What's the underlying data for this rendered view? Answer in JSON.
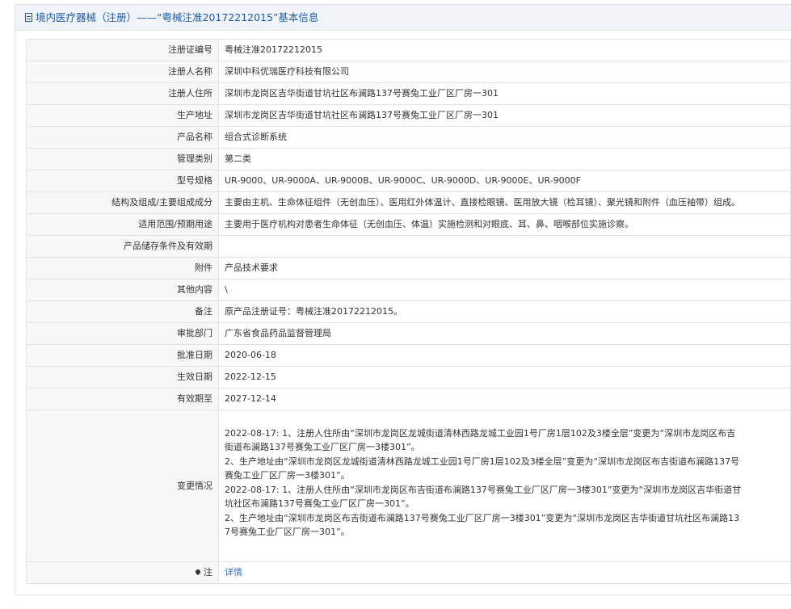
{
  "header": {
    "title": "境内医疗器械（注册）——“粤械注准20172212015”基本信息"
  },
  "rows": [
    {
      "label": "注册证编号",
      "value": "粤械注准20172212015"
    },
    {
      "label": "注册人名称",
      "value": "深圳中科优瑞医疗科技有限公司"
    },
    {
      "label": "注册人住所",
      "value": "深圳市龙岗区吉华街道甘坑社区布澜路137号赛兔工业厂区厂房一301"
    },
    {
      "label": "生产地址",
      "value": "深圳市龙岗区吉华街道甘坑社区布澜路137号赛兔工业厂区厂房一301"
    },
    {
      "label": "产品名称",
      "value": "组合式诊断系统"
    },
    {
      "label": "管理类别",
      "value": "第二类"
    },
    {
      "label": "型号规格",
      "value": "UR-9000、UR-9000A、UR-9000B、UR-9000C、UR-9000D、UR-9000E、UR-9000F"
    },
    {
      "label": "结构及组成/主要组成成分",
      "value": "主要由主机、生命体征组件（无创血压）、医用红外体温计、直接检眼镜、医用放大镜（检耳镜）、聚光镜和附件（血压袖带）组成。"
    },
    {
      "label": "适用范围/预期用途",
      "value": "主要用于医疗机构对患者生命体征（无创血压、体温）实施检测和对眼底、耳、鼻、咽喉部位实施诊察。"
    },
    {
      "label": "产品储存条件及有效期",
      "value": ""
    },
    {
      "label": "附件",
      "value": "产品技术要求"
    },
    {
      "label": "其他内容",
      "value": "\\"
    },
    {
      "label": "备注",
      "value": "原产品注册证号：粤械注准20172212015。"
    },
    {
      "label": "审批部门",
      "value": "广东省食品药品监督管理局"
    },
    {
      "label": "批准日期",
      "value": "2020-06-18"
    },
    {
      "label": "生效日期",
      "value": "2022-12-15"
    },
    {
      "label": "有效期至",
      "value": "2027-12-14"
    }
  ],
  "changes": {
    "label": "变更情况",
    "entry1_line1": "2022-08-17: 1、注册人住所由“深圳市龙岗区龙城街道清林西路龙城工业园1号厂房1层102及3楼全层”变更为“深圳市龙岗区布吉",
    "entry1_line2": "街道布澜路137号赛兔工业厂区厂房一3楼301”。",
    "entry1_line3": "2、生产地址由“深圳市龙岗区龙城街道清林西路龙城工业园1号厂房1层102及3楼全层”变更为“深圳市龙岗区布吉街道布澜路137号",
    "entry1_line4": "赛兔工业厂区厂房一3楼301”。",
    "entry2_line1": "2022-08-17: 1、注册人住所由“深圳市龙岗区布吉街道布澜路137号赛兔工业厂区厂房一3楼301”变更为“深圳市龙岗区吉华街道甘",
    "entry2_line2": "坑社区布澜路137号赛兔工业厂区厂房一301”。",
    "entry2_line3": "2、生产地址由“深圳市龙岗区布吉街道布澜路137号赛兔工业厂区厂房一3楼301”变更为“深圳市龙岗区吉华街道甘坑社区布澜路13",
    "entry2_line4": "7号赛兔工业厂区厂房一301”。"
  },
  "note": {
    "label": "注",
    "icon": "pin-icon",
    "link": "详情"
  }
}
